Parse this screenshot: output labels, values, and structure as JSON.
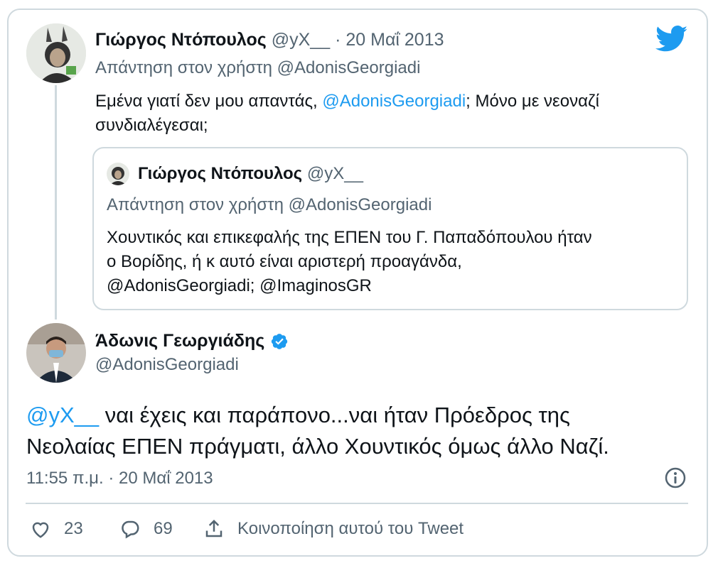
{
  "reply_tweet": {
    "author_name": "Γιώργος Ντόπουλος",
    "handle": "@yX__",
    "separator": "·",
    "date": "20 Μαΐ 2013",
    "reply_prefix": "Απάντηση στον χρήστη",
    "reply_to": "@AdonisGeorgiadi",
    "text_part1": "Εμένα γιατί δεν μου απαντάς,",
    "text_mention": "@AdonisGeorgiadi",
    "text_part2": "; Μόνο με νεοναζί",
    "text_line2": "συνδιαλέγεσαι;"
  },
  "quoted_tweet": {
    "author_name": "Γιώργος Ντόπουλος",
    "handle": "@yX__",
    "reply_prefix": "Απάντηση στον χρήστη",
    "reply_to": "@AdonisGeorgiadi",
    "line1": "Χουντικός και επικεφαλής της ΕΠΕΝ του Γ. Παπαδόπουλου ήταν",
    "line2": "ο Βορίδης, ή κ αυτό είναι αριστερή προαγάνδα,",
    "line3": "@AdonisGeorgiadi; @ImaginosGR"
  },
  "main_tweet": {
    "author_name": "Άδωνις Γεωργιάδης",
    "handle": "@AdonisGeorgiadi",
    "mention": "@yX__",
    "text_line1": " ναι έχεις και παράπονο...ναι ήταν Πρόεδρος της",
    "text_line2": "Νεολαίας ΕΠΕΝ πράγματι, άλλο Χουντικός όμως άλλο Ναζί.",
    "timestamp": "11:55 π.μ. · 20 Μαΐ 2013"
  },
  "actions": {
    "likes": "23",
    "replies": "69",
    "share_label": "Κοινοποίηση αυτού του Tweet"
  },
  "icons": {
    "brand": "twitter-bird-icon",
    "verified": "verified-badge-icon",
    "info": "info-icon",
    "like": "heart-icon",
    "reply": "reply-bubble-icon",
    "share": "share-icon"
  },
  "colors": {
    "brand_blue": "#1d9bf0",
    "muted_text": "#536471",
    "border": "#cfd9de"
  }
}
